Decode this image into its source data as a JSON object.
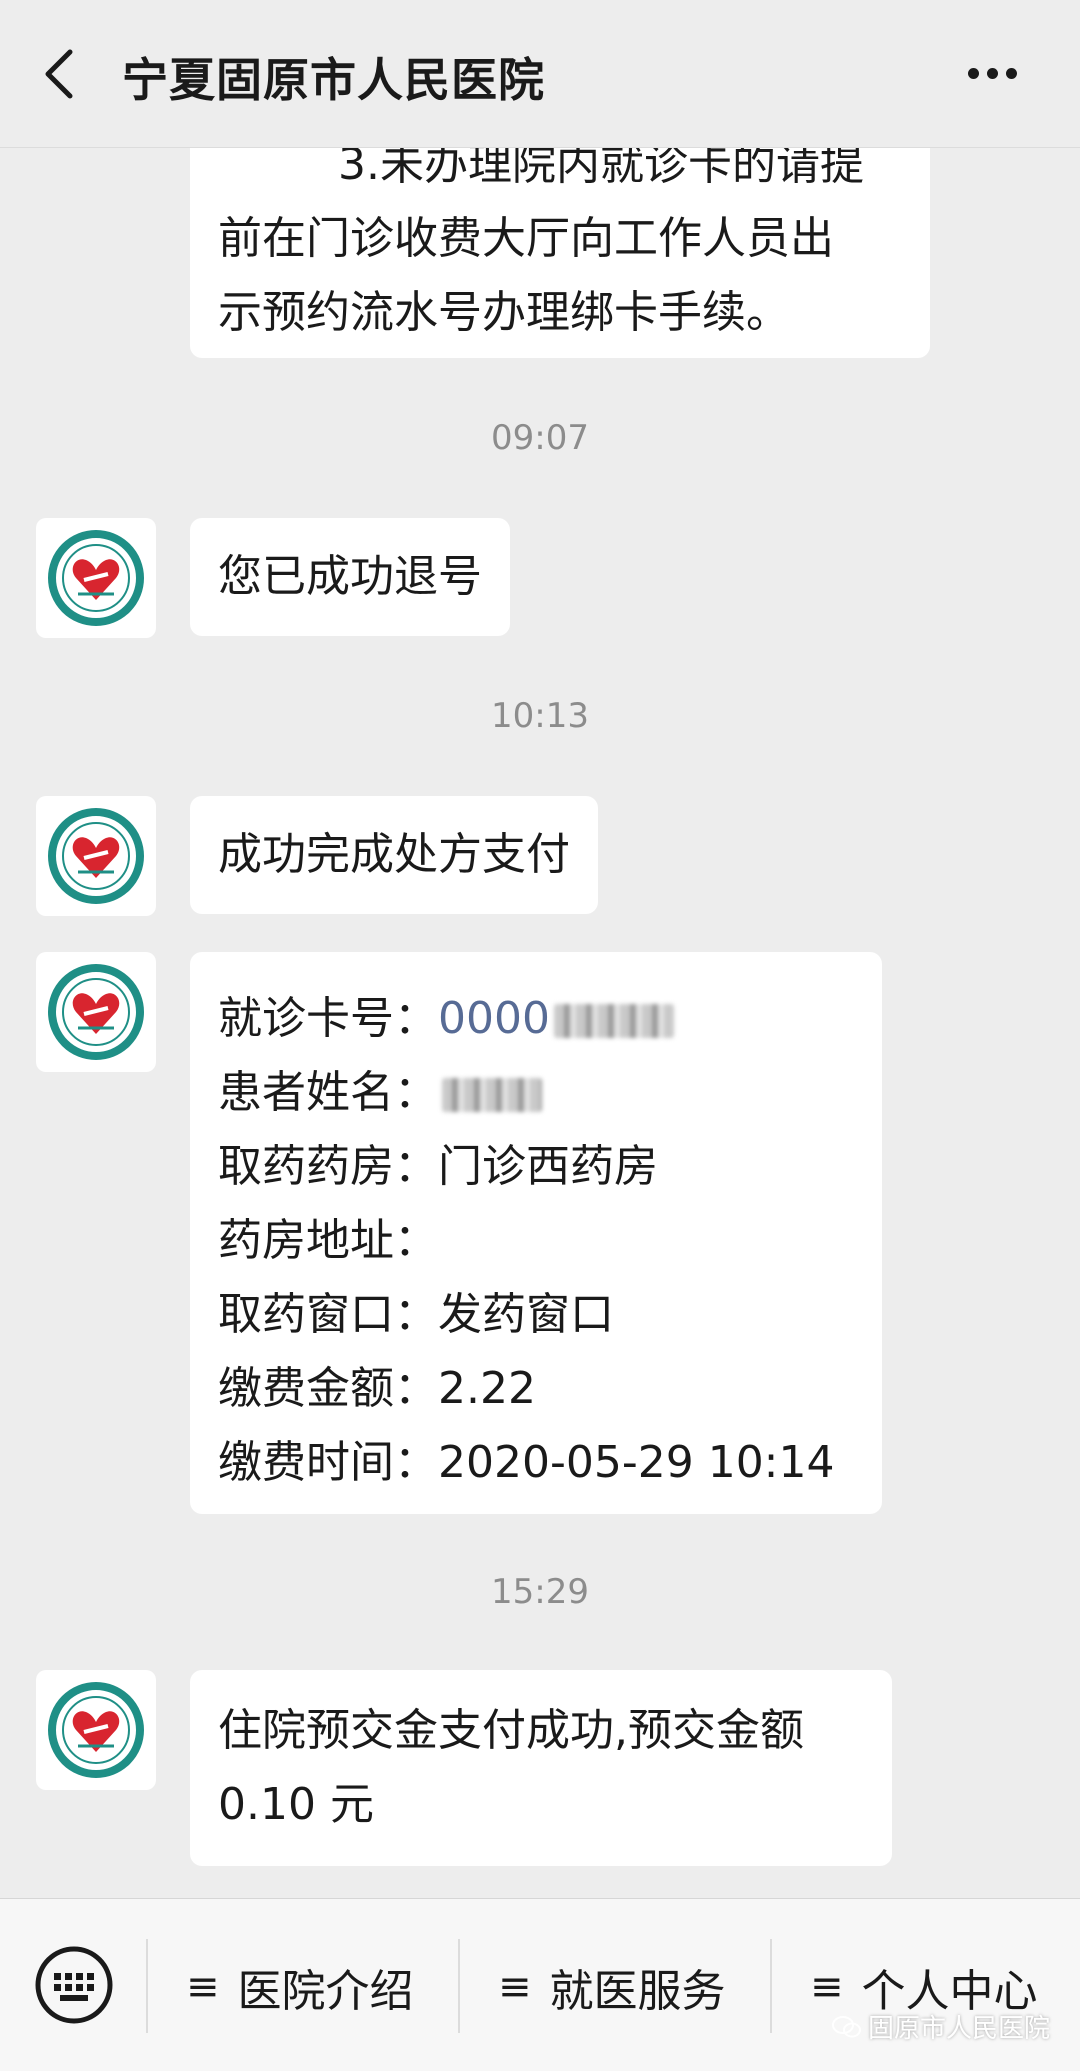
{
  "header": {
    "title": "宁夏固原市人民医院"
  },
  "messages": {
    "partial_lines": [
      "3.未办理院内就诊卡的请提",
      "前在门诊收费大厅向工作人员出",
      "示预约流水号办理绑卡手续。"
    ],
    "time1": "09:07",
    "msg1": "您已成功退号",
    "time2": "10:13",
    "msg2": "成功完成处方支付",
    "detail": {
      "card_label": "就诊卡号：",
      "card_value": "0000",
      "name_label": "患者姓名：",
      "pharmacy_label": "取药药房：",
      "pharmacy_value": "门诊西药房",
      "address_label": "药房地址：",
      "address_value": "",
      "window_label": "取药窗口：",
      "window_value": "发药窗口",
      "amount_label": "缴费金额：",
      "amount_value": "2.22",
      "time_label": "缴费时间：",
      "time_value": "2020-05-29 10:14"
    },
    "time3": "15:29",
    "msg3_line1": "住院预交金支付成功,预交金额",
    "msg3_line2": "0.10 元"
  },
  "menu": {
    "items": [
      {
        "label": "医院介绍"
      },
      {
        "label": "就医服务"
      },
      {
        "label": "个人中心"
      }
    ],
    "burger": "≡",
    "watermark": "固原市人民医院"
  },
  "colors": {
    "background": "#ededed",
    "bubble": "#ffffff",
    "link": "#576b95",
    "timestamp": "#8c8c8c",
    "logo_teal": "#1f8f86",
    "logo_red": "#d8252f"
  },
  "icons": {
    "back": "chevron-left-icon",
    "more": "more-dots-icon",
    "keyboard": "keyboard-icon",
    "avatar": "hospital-logo-icon",
    "watermark": "wechat-icon"
  }
}
